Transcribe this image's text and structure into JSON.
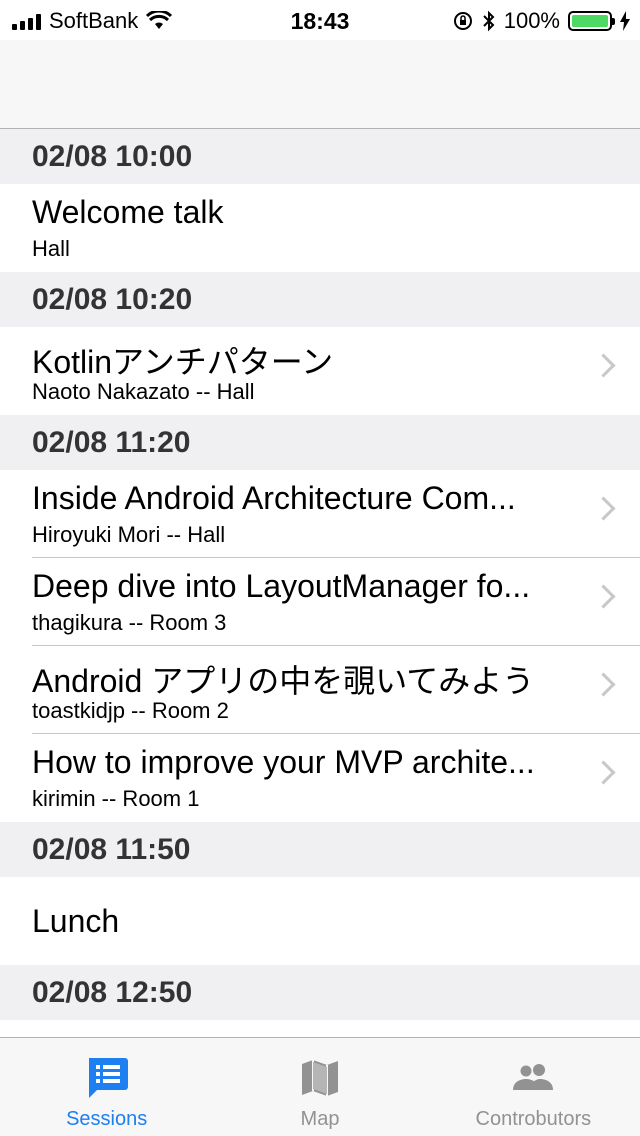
{
  "status_bar": {
    "carrier": "SoftBank",
    "time": "18:43",
    "battery_percent": "100%",
    "icons": [
      "signal-icon",
      "wifi-icon",
      "orientation-lock-icon",
      "bluetooth-icon",
      "battery-icon",
      "charging-icon"
    ]
  },
  "sections": [
    {
      "header": "02/08 10:00",
      "rows": [
        {
          "title": "Welcome talk",
          "subtitle": "Hall",
          "chevron": false
        }
      ]
    },
    {
      "header": "02/08 10:20",
      "rows": [
        {
          "title": "Kotlinアンチパターン",
          "subtitle": "Naoto Nakazato -- Hall",
          "chevron": true
        }
      ]
    },
    {
      "header": "02/08 11:20",
      "rows": [
        {
          "title": "Inside Android Architecture Com...",
          "subtitle": "Hiroyuki Mori -- Hall",
          "chevron": true
        },
        {
          "title": "Deep dive into LayoutManager fo...",
          "subtitle": "thagikura -- Room 3",
          "chevron": true
        },
        {
          "title": "Android アプリの中を覗いてみよう",
          "subtitle": "toastkidjp -- Room 2",
          "chevron": true
        },
        {
          "title": "How to improve your MVP archite...",
          "subtitle": "kirimin -- Room 1",
          "chevron": true
        }
      ]
    },
    {
      "header": "02/08 11:50",
      "rows": [
        {
          "title": "Lunch",
          "subtitle": "",
          "chevron": false
        }
      ]
    },
    {
      "header": "02/08 12:50",
      "rows": []
    }
  ],
  "tab_bar": {
    "tabs": [
      {
        "label": "Sessions",
        "icon": "list-icon",
        "active": true
      },
      {
        "label": "Map",
        "icon": "map-icon",
        "active": false
      },
      {
        "label": "Controbutors",
        "icon": "people-icon",
        "active": false
      }
    ],
    "active_color": "#1d7ff0",
    "inactive_color": "#929292"
  }
}
